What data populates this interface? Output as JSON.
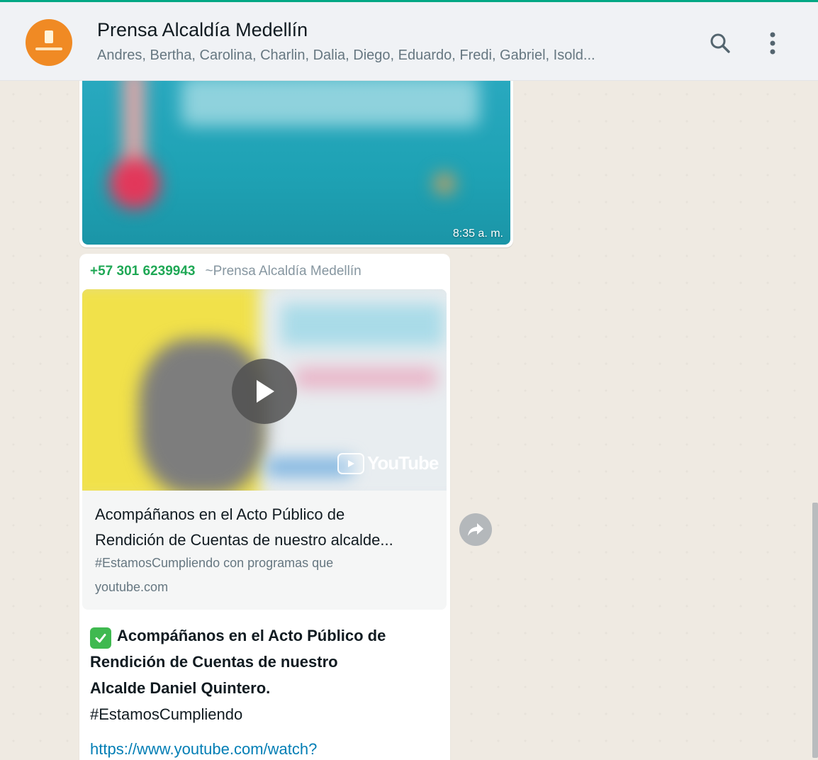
{
  "header": {
    "title": "Prensa Alcaldía Medellín",
    "participants": "Andres, Bertha, Carolina, Charlin, Dalia, Diego, Eduardo, Fredi, Gabriel, Isold...",
    "accent_color": "#00a884",
    "avatar_color": "#f08a24",
    "icons": [
      "search-icon",
      "menu-icon"
    ]
  },
  "messages": {
    "media": {
      "time": "8:35 a. m."
    },
    "link_message": {
      "sender_phone": "+57 301 6239943",
      "sender_name": "~Prensa Alcaldía Medellín",
      "preview": {
        "title_line1": "Acompáñanos en el Acto Público de",
        "title_line2": "Rendición de Cuentas de nuestro alcalde...",
        "description": "#EstamosCumpliendo con programas que",
        "domain": "youtube.com",
        "video_brand": "YouTube"
      },
      "text_line1": "Acompáñanos en el Acto Público de",
      "text_line2": "Rendición de Cuentas de nuestro",
      "text_line3": "Alcalde Daniel Quintero.",
      "hashtag": "#EstamosCumpliendo",
      "link": "https://www.youtube.com/watch?"
    }
  }
}
